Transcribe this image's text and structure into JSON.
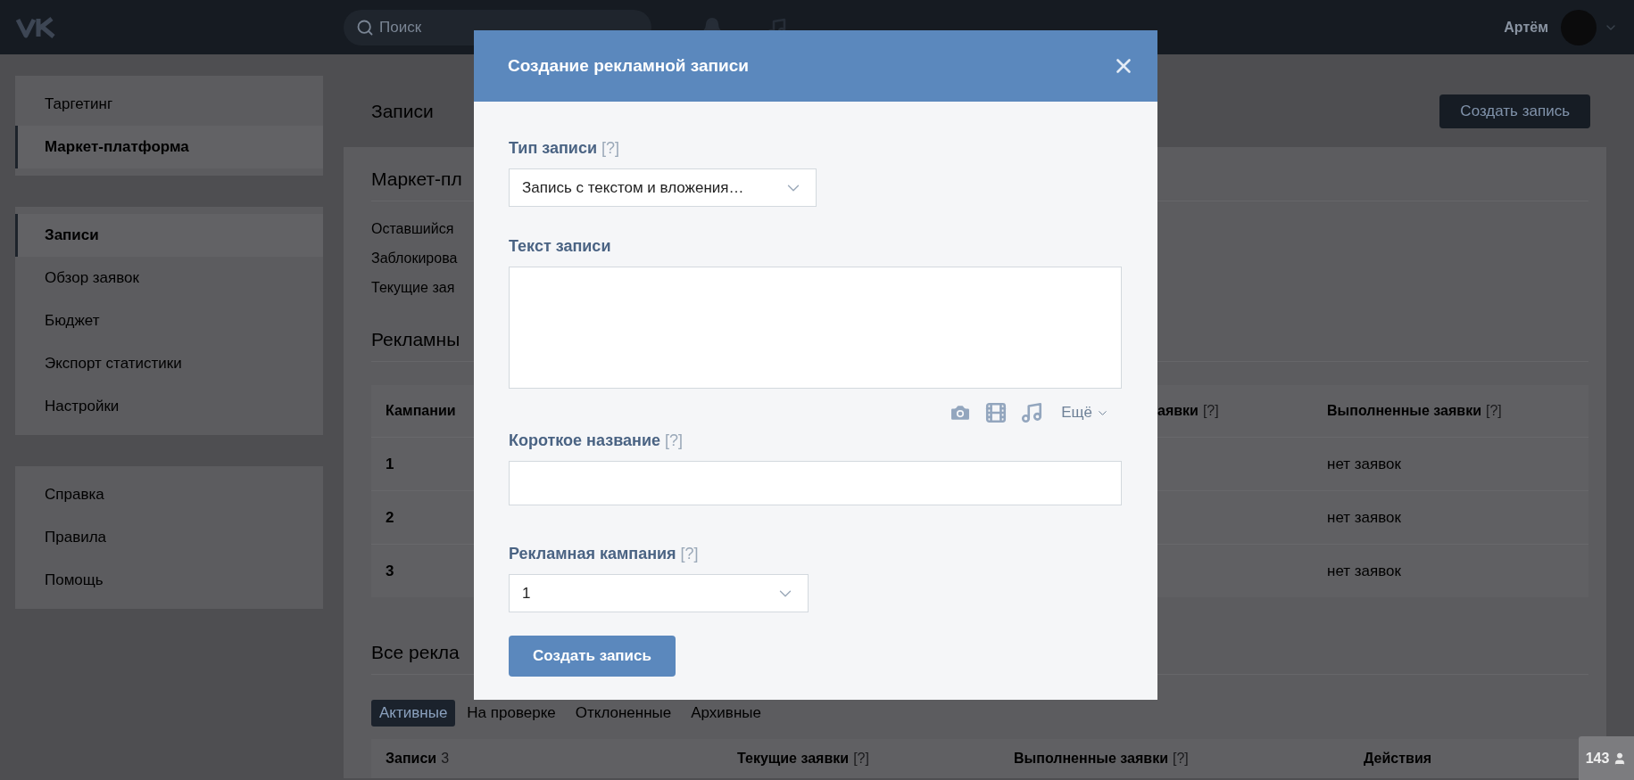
{
  "topbar": {
    "search": {
      "placeholder": "Поиск"
    },
    "user": {
      "name": "Артём"
    }
  },
  "sidebar": {
    "groups": [
      {
        "items": [
          {
            "label": "Таргетинг",
            "selected": false
          },
          {
            "label": "Маркет-платформа",
            "selected": true
          }
        ]
      },
      {
        "items": [
          {
            "label": "Записи",
            "selected": true
          },
          {
            "label": "Обзор заявок",
            "selected": false
          },
          {
            "label": "Бюджет",
            "selected": false
          },
          {
            "label": "Экспорт статистики",
            "selected": false
          },
          {
            "label": "Настройки",
            "selected": false
          }
        ]
      },
      {
        "items": [
          {
            "label": "Справка",
            "selected": false
          },
          {
            "label": "Правила",
            "selected": false
          },
          {
            "label": "Помощь",
            "selected": false
          }
        ]
      }
    ]
  },
  "page": {
    "title": "Записи",
    "create_button": "Создать запись",
    "summary": {
      "title": "Маркет-пл",
      "lines": [
        "Оставшийся",
        "Заблокирова",
        "Текущие зая"
      ]
    },
    "campaigns": {
      "title": "Рекламны",
      "columns": [
        {
          "label": "Кампании"
        },
        {
          "label": "аявки",
          "hint": "[?]"
        },
        {
          "label": "Выполненные заявки",
          "hint": "[?]"
        }
      ],
      "rows": [
        {
          "campaign": "1",
          "completed": "нет заявок"
        },
        {
          "campaign": "2",
          "completed": "нет заявок"
        },
        {
          "campaign": "3",
          "completed": "нет заявок"
        }
      ]
    },
    "all_posts": {
      "title": "Все рекла",
      "tabs": [
        {
          "label": "Активные",
          "selected": true
        },
        {
          "label": "На проверке",
          "selected": false
        },
        {
          "label": "Отклоненные",
          "selected": false
        },
        {
          "label": "Архивные",
          "selected": false
        }
      ],
      "columns": [
        {
          "label": "Записи",
          "count": "3"
        },
        {
          "label": "Текущие заявки",
          "hint": "[?]"
        },
        {
          "label": "Выполненные заявки",
          "hint": "[?]"
        },
        {
          "label": "Действия"
        }
      ]
    }
  },
  "modal": {
    "title": "Создание рекламной записи",
    "fields": [
      {
        "kind": "select",
        "label": "Тип записи",
        "hint": "[?]",
        "value": "Запись с текстом и вложения…"
      },
      {
        "kind": "textarea",
        "label": "Текст записи",
        "more": "Ещё"
      },
      {
        "kind": "input",
        "label": "Короткое название",
        "hint": "[?]"
      },
      {
        "kind": "select",
        "label": "Рекламная кампания",
        "hint": "[?]",
        "value": "1"
      }
    ],
    "submit": "Создать запись"
  },
  "online_badge": {
    "count": "143"
  }
}
